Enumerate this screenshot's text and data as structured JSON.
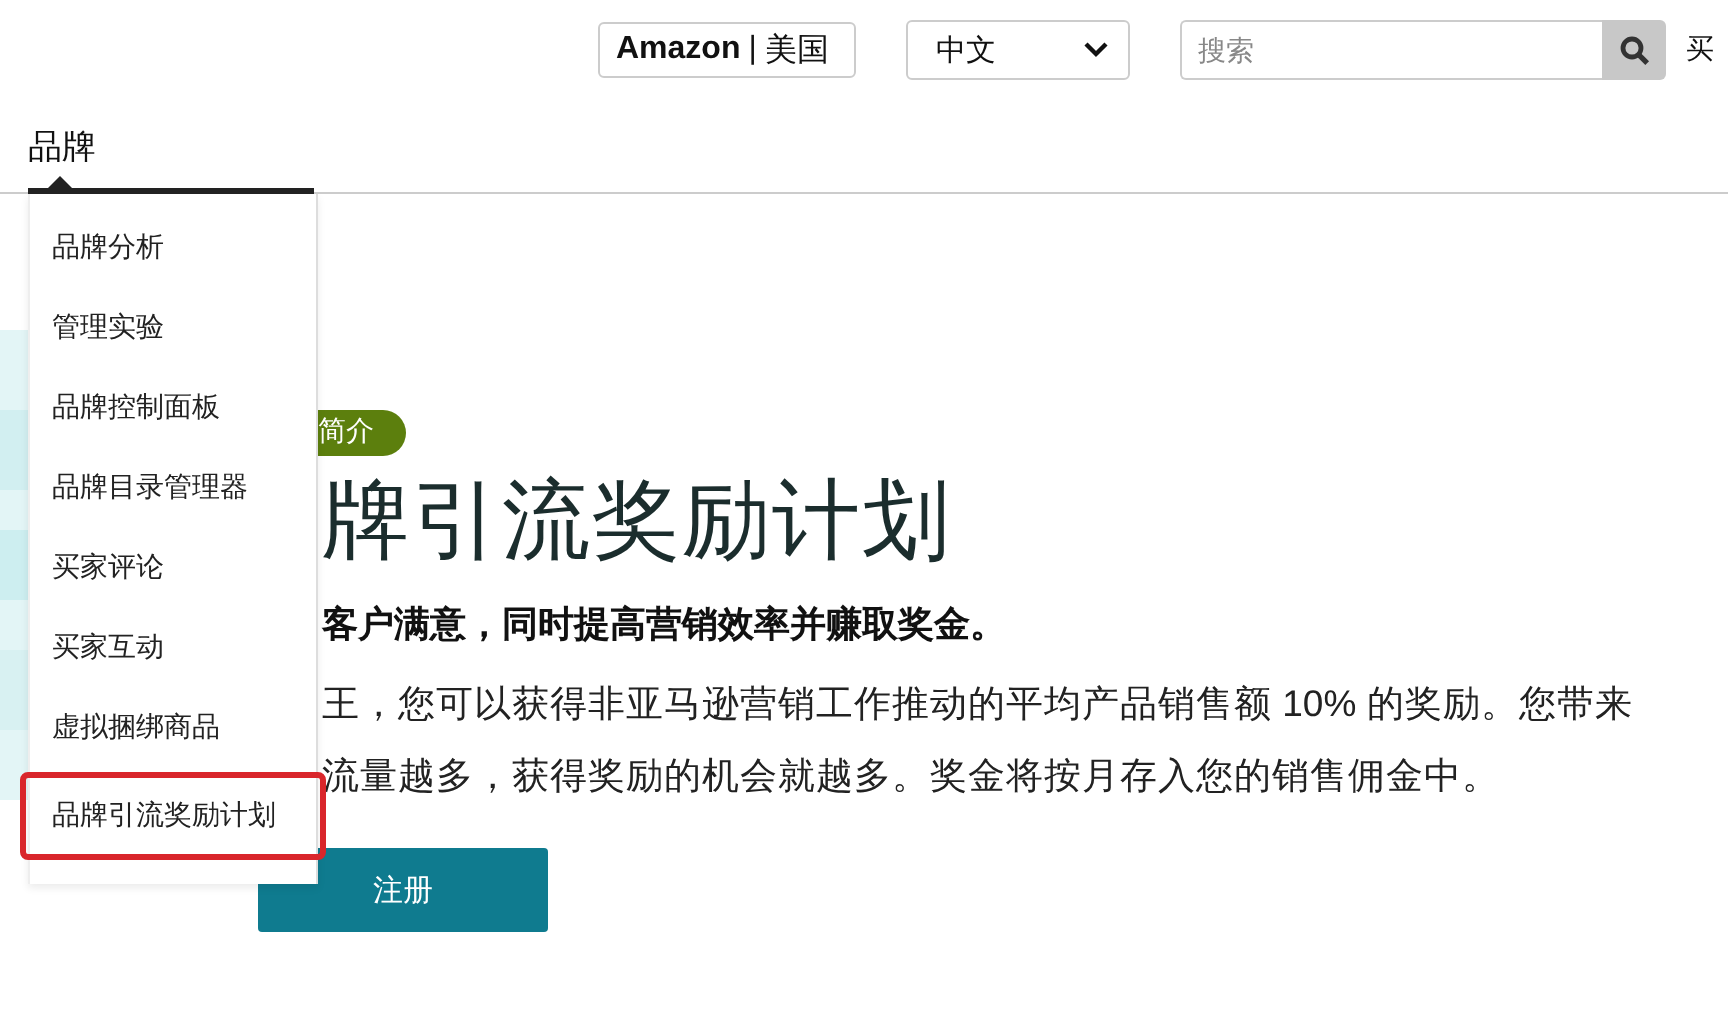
{
  "header": {
    "marketplace": {
      "brand": "Amazon",
      "separator": "|",
      "region": "美国"
    },
    "language": "中文",
    "search": {
      "placeholder": "搜索"
    },
    "cut_link": "买"
  },
  "nav": {
    "tabs": [
      {
        "label": "品牌",
        "selected": true
      }
    ]
  },
  "menu": {
    "items": [
      {
        "label": "品牌分析",
        "selected": false
      },
      {
        "label": "管理实验",
        "selected": false
      },
      {
        "label": "品牌控制面板",
        "selected": false
      },
      {
        "label": "品牌目录管理器",
        "selected": false
      },
      {
        "label": "买家评论",
        "selected": false
      },
      {
        "label": "买家互动",
        "selected": false
      },
      {
        "label": "虚拟捆绑商品",
        "selected": false
      },
      {
        "label": "品牌引流奖励计划",
        "selected": true
      }
    ]
  },
  "hero": {
    "kind": "picture",
    "badge": "简介",
    "title": "牌引流奖励计划",
    "subtitle": "客户满意，同时提高营销效率并赚取奖金。",
    "paragraph_lines": [
      "王，您可以获得非亚马逊营销工作推动的平均产品销售额 10% 的奖励。您带来",
      "流量越多，获得奖励的机会就越多。奖金将按月存入您的销售佣金中。"
    ],
    "button": "注册"
  }
}
